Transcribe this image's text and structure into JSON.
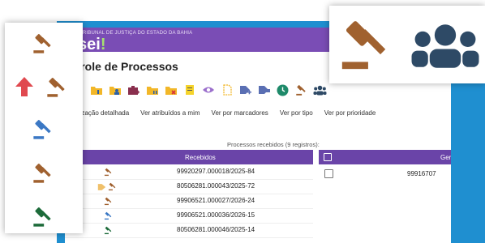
{
  "header": {
    "org_name": "TRIBUNAL DE JUSTIÇA DO ESTADO DA BAHIA",
    "logo_text": "sei",
    "logo_dot": "!"
  },
  "page": {
    "title": "ntrole de Processos"
  },
  "toolbar": {
    "icons": [
      "share-icon",
      "folder-info-icon",
      "folder-user-icon",
      "briefcase-add-icon",
      "folder-pause-icon",
      "folder-remove-icon",
      "note-icon",
      "eye-icon",
      "document-icon",
      "tag-add-icon",
      "tag-icon",
      "clock-icon",
      "gavel-icon",
      "users-icon"
    ]
  },
  "views": {
    "detailed": "ualização detalhada",
    "assigned": "Ver atribuídos a mim",
    "by_marker": "Ver por marcadores",
    "by_type": "Ver por tipo",
    "by_priority": "Ver por prioridade"
  },
  "table": {
    "count_label": "Processos recebidos (9 registros):",
    "received_header": "Recebidos",
    "generated_header": "Gera",
    "rows": [
      {
        "number": "99920297.000018/2025-84",
        "icons": [
          "gavel-icon-brown"
        ]
      },
      {
        "number": "80506281.000043/2025-72",
        "icons": [
          "tag-icon-orange",
          "gavel-icon-brown"
        ]
      },
      {
        "number": "99906521.000027/2026-24",
        "icons": [
          "gavel-icon-brown"
        ]
      },
      {
        "number": "99906521.000036/2026-15",
        "icons": [
          "gavel-icon-blue"
        ]
      },
      {
        "number": "80506281.000046/2025-14",
        "icons": [
          "gavel-icon-green"
        ]
      }
    ],
    "generated_rows": [
      {
        "number": "99916707"
      }
    ]
  },
  "zoom_left": {
    "icons": [
      "gavel-icon-brown",
      "up-arrow-icon-red",
      "gavel-icon-brown",
      "gavel-icon-blue",
      "gavel-icon-brown",
      "gavel-icon-green"
    ]
  },
  "zoom_right": {
    "icons": [
      "gavel-icon-brown",
      "users-icon-navy"
    ]
  },
  "colors": {
    "header_purple": "#7a4db5",
    "table_header_purple": "#6a44a8",
    "frame_blue": "#1f8fd0",
    "gavel_brown": "#a0612f",
    "gavel_blue": "#3b78c4",
    "gavel_green": "#1d6b3a",
    "arrow_red": "#e0494f",
    "users_navy": "#2e4a66"
  }
}
